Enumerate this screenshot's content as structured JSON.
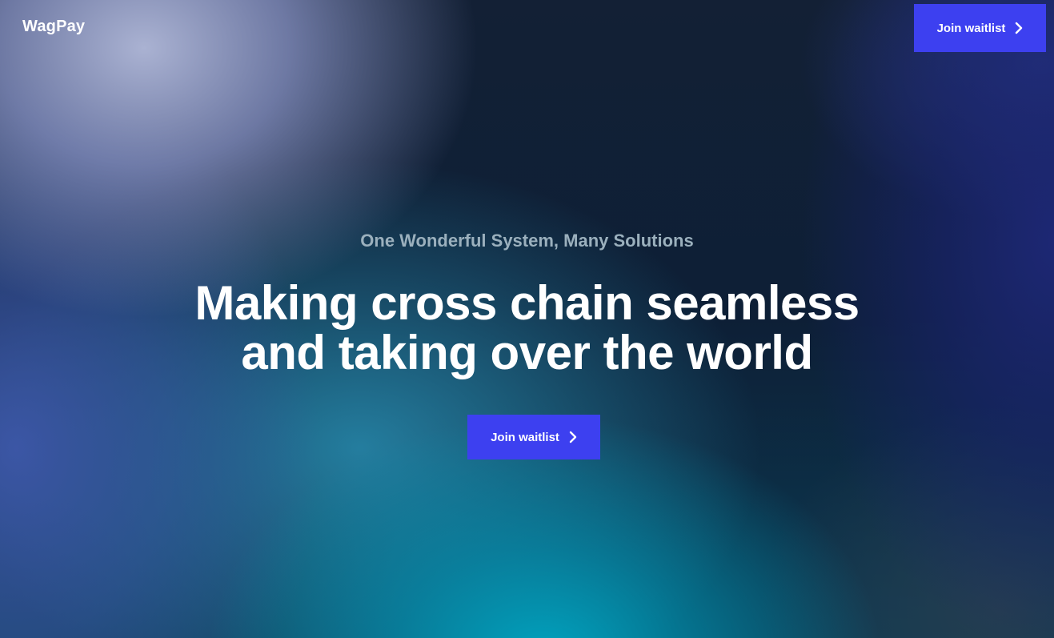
{
  "brand": {
    "name": "WagPay"
  },
  "header": {
    "cta_label": "Join waitlist",
    "cta_icon": "chevron-right-icon"
  },
  "hero": {
    "eyebrow": "One Wonderful System, Many Solutions",
    "headline_line1": "Making cross chain seamless",
    "headline_line2": "and taking over the world",
    "cta_label": "Join waitlist",
    "cta_icon": "chevron-right-icon"
  },
  "colors": {
    "accent": "#3d40f0",
    "eyebrow_text": "#9bb0bd",
    "text": "#ffffff"
  }
}
